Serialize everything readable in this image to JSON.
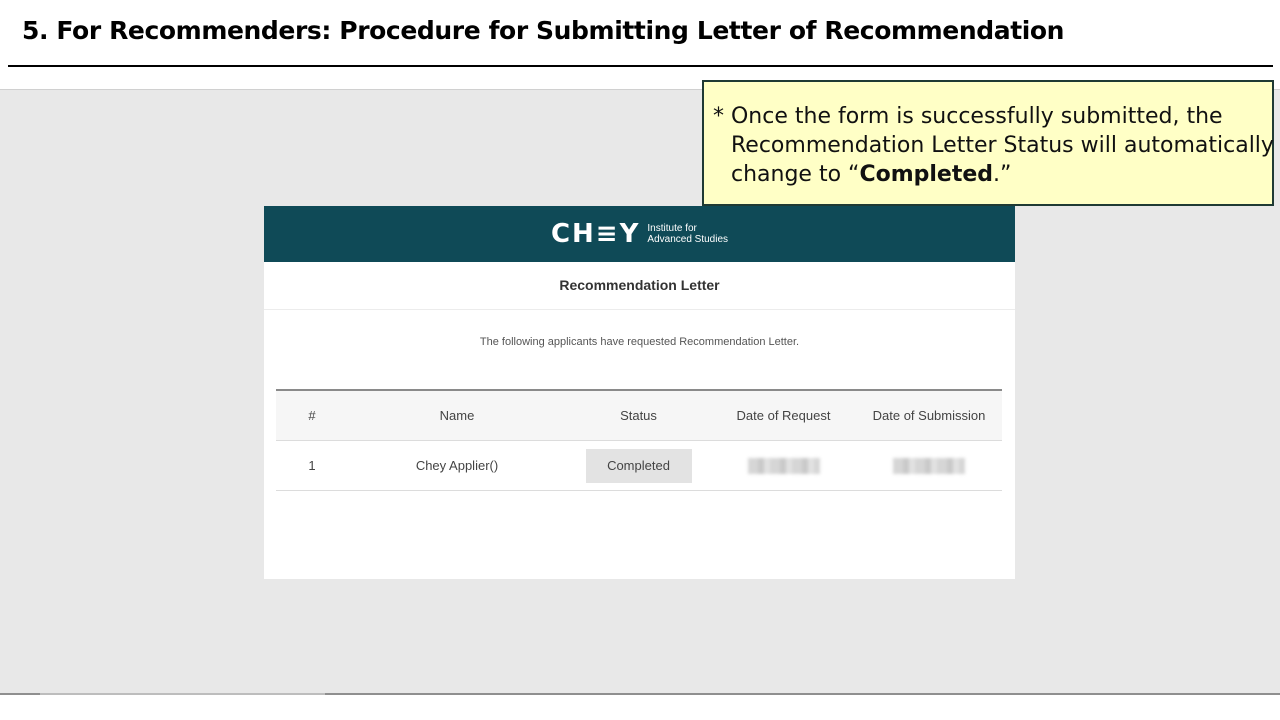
{
  "slide": {
    "title": "5. For Recommenders: Procedure for Submitting Letter of Recommendation"
  },
  "callout": {
    "line1": "* Once the form is successfully submitted, the",
    "line2": "Recommendation Letter Status will automatically",
    "line3_prefix": "change to “",
    "line3_bold": "Completed",
    "line3_suffix": ".”"
  },
  "portal": {
    "logo_word": "CH≡Y",
    "logo_line1": "Institute for",
    "logo_line2": "Advanced Studies",
    "page_title": "Recommendation Letter",
    "notice": "The following applicants have requested Recommendation Letter.",
    "table": {
      "headers": [
        "#",
        "Name",
        "Status",
        "Date of Request",
        "Date of Submission"
      ],
      "rows": [
        {
          "num": "1",
          "name": "Chey Applier()",
          "status": "Completed"
        }
      ]
    }
  },
  "colors": {
    "header_bg": "#0f4a57",
    "callout_bg": "#ffffc6",
    "callout_border": "#1f3a34"
  }
}
